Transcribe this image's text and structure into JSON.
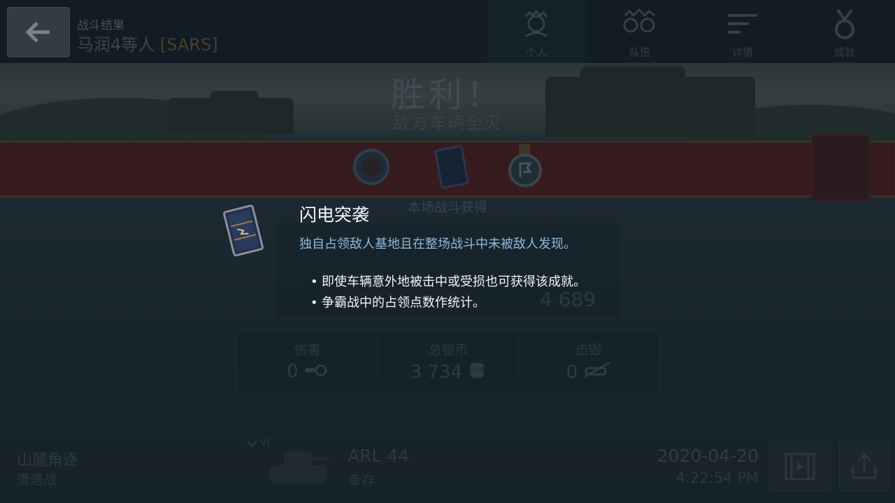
{
  "header": {
    "subtitle": "战斗结果",
    "player_group": "马润4等人",
    "clan_tag": "[SARS]"
  },
  "tabs": [
    {
      "label": "个人",
      "icon": "person-laurel-icon",
      "active": true
    },
    {
      "label": "队伍",
      "icon": "team-laurel-icon",
      "active": false
    },
    {
      "label": "详情",
      "icon": "details-lines-icon",
      "active": false
    },
    {
      "label": "成就",
      "icon": "medal-icon",
      "active": false
    }
  ],
  "result": {
    "title": "胜利！",
    "subtitle": "敌方车辆全灭",
    "earned_label": "本场战斗获得",
    "medal_icons": [
      "laurel-medal-icon",
      "blitz-book-icon",
      "capture-medal-icon"
    ]
  },
  "stats_partial_value": "4 689",
  "stats": [
    {
      "label": "伤害",
      "value": "0",
      "icon": "shell-icon"
    },
    {
      "label": "总银币",
      "value": "3 734",
      "icon": "coins-icon"
    },
    {
      "label": "击毁",
      "value": "0",
      "icon": "destroyed-tank-icon"
    }
  ],
  "battle": {
    "map": "山麓角逐",
    "mode": "遭遇战",
    "tier": "VI",
    "vehicle": "ARL 44",
    "status": "幸存",
    "date": "2020-04-20",
    "time": "4:22:54 PM"
  },
  "buttons": {
    "replay_icon": "film-icon",
    "share_icon": "share-icon"
  },
  "achievement": {
    "title": "闪电突袭",
    "description": "独自占领敌人基地且在整场战斗中未被敌人发现。",
    "notes": [
      "即使车辆意外地被击中或受损也可获得该成就。",
      "争霸战中的占领点数作统计。"
    ],
    "icon": "blitz-book-icon",
    "colors": {
      "title": "#f4f7f9",
      "description": "#8fb8dd"
    }
  }
}
